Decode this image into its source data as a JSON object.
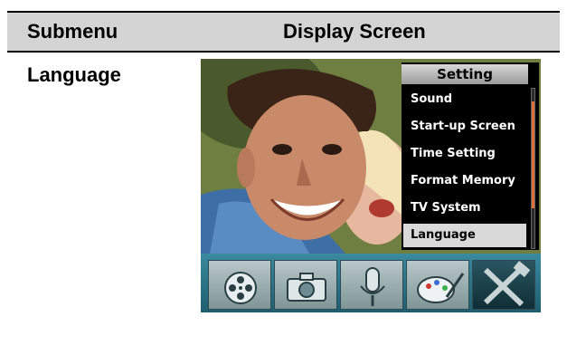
{
  "table": {
    "header": {
      "col1": "Submenu",
      "col2": "Display Screen"
    },
    "row": {
      "submenu": "Language"
    }
  },
  "screen": {
    "menu": {
      "title": "Setting",
      "items": [
        {
          "label": "Sound"
        },
        {
          "label": "Start-up Screen"
        },
        {
          "label": "Time Setting"
        },
        {
          "label": "Format Memory"
        },
        {
          "label": "TV System"
        },
        {
          "label": "Language",
          "selected": true
        }
      ]
    },
    "toolbar": {
      "icons": [
        "film-reel-icon",
        "camera-icon",
        "microphone-icon",
        "palette-icon",
        "tools-icon"
      ],
      "active": "tools-icon"
    }
  }
}
